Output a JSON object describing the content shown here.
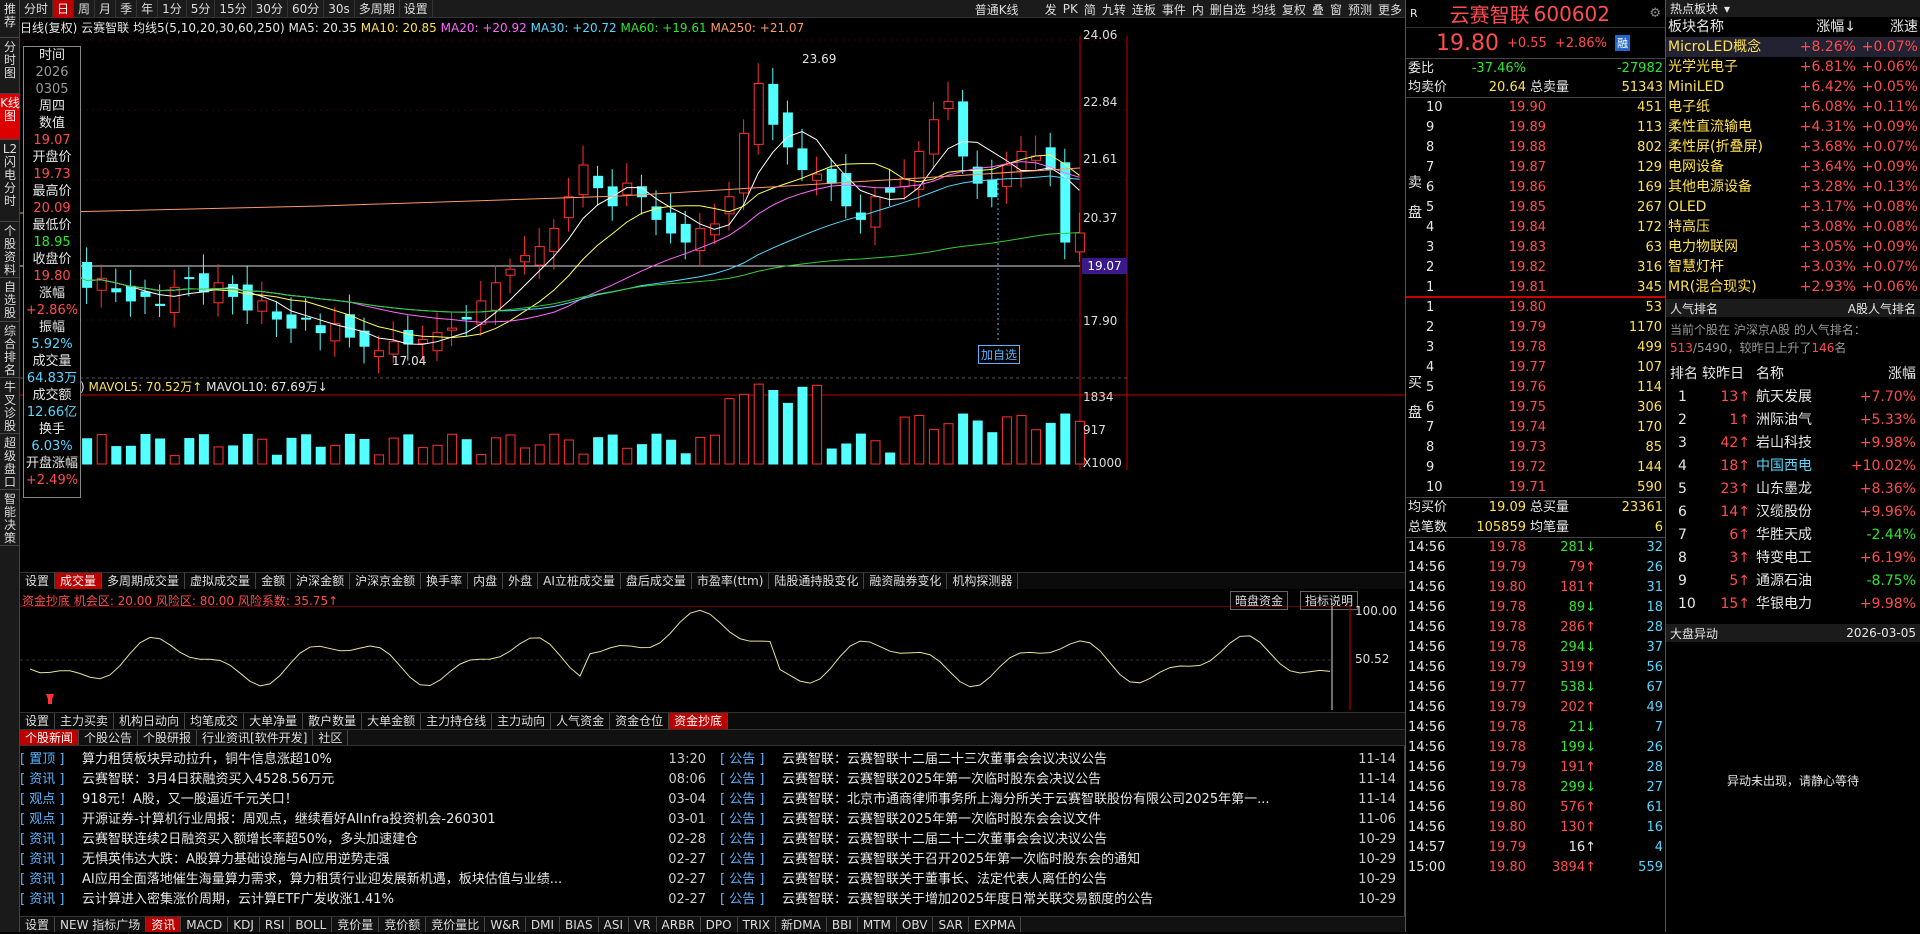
{
  "left_tabs": [
    "推荐",
    "分时图",
    "K线图",
    "L2闪电分时",
    "个股资料",
    "自选股",
    "综合排名",
    "牛叉诊股",
    "超级盘口",
    "智能决策"
  ],
  "top": {
    "periods": [
      "分时",
      "日",
      "周",
      "月",
      "季",
      "年",
      "1分",
      "5分",
      "15分",
      "30分",
      "60分",
      "30s",
      "多周期",
      "设置"
    ],
    "active_period": "日",
    "right": [
      "普通K线",
      "发",
      "PK",
      "简",
      "九转",
      "连板",
      "事件",
      "内",
      "删自选",
      "均线",
      "复权",
      "叠",
      "窗",
      "预测",
      "更多"
    ]
  },
  "chart": {
    "header": "日线(复权)  云赛智联  均线5(5,10,20,30,60,250)",
    "ma5": "MA5: 20.35",
    "ma10": "MA10: 20.85",
    "ma20": "MA20: +20.92",
    "ma30": "MA30: +20.72",
    "ma60": "MA60: +19.61",
    "ma250": "MA250: +21.07",
    "price_ticks": [
      "24.06",
      "22.84",
      "21.61",
      "20.37",
      "19.07",
      "17.90"
    ],
    "high_label": "23.69",
    "low_label": "17.04",
    "current_price_label": "19.07",
    "add_watch": "加自选"
  },
  "infobox": {
    "time_label": "时间",
    "date_year": "2026",
    "date_md": "0305",
    "weekday": "周四",
    "value_label": "数值",
    "value": "19.07",
    "open_label": "开盘价",
    "open": "19.73",
    "high_label": "最高价",
    "high": "20.09",
    "low_label": "最低价",
    "low": "18.95",
    "close_label": "收盘价",
    "close": "19.80",
    "chg_label": "涨幅",
    "chg": "+2.86%",
    "amp_label": "振幅",
    "amp": "5.92%",
    "vol_label": "成交量",
    "vol": "64.83万",
    "amt_label": "成交额",
    "amt": "12.66亿",
    "turn_label": "换手",
    "turn": "6.03%",
    "open_chg_label": "开盘涨幅",
    "open_chg": "+2.49%"
  },
  "volume": {
    "header_a": "万)",
    "mavol5": "MAVOL5: 70.52万↑",
    "mavol10": "MAVOL10: 67.69万↓",
    "ticks": [
      "1834",
      "917",
      "X1000"
    ]
  },
  "vol_tabs": [
    "设置",
    "成交量",
    "多周期成交量",
    "虚拟成交量",
    "金额",
    "沪深金额",
    "沪深京金额",
    "换手率",
    "内盘",
    "外盘",
    "AI立桩成交量",
    "盘后成交量",
    "市盈率(ttm)",
    "陆股通持股变化",
    "融资融券变化",
    "机构探测器"
  ],
  "indicator": {
    "header": "资金抄底 机会区: 20.00  风险区: 80.00  风险系数: 35.75↑",
    "btn1": "暗盘资金",
    "btn2": "指标说明",
    "ticks": [
      "100.00",
      "50.52"
    ]
  },
  "ind_tabs": [
    "设置",
    "主力买卖",
    "机构日动向",
    "均笔成交",
    "大单净量",
    "散户数量",
    "大单金额",
    "主力持仓线",
    "主力动向",
    "人气资金",
    "资金仓位",
    "资金抄底"
  ],
  "news_tabs": [
    "个股新闻",
    "个股公告",
    "个股研报",
    "行业资讯[软件开发]",
    "社区"
  ],
  "news_left": [
    [
      "置顶",
      "算力租赁板块异动拉升，铜牛信息涨超10%",
      "13:20"
    ],
    [
      "资讯",
      "云赛智联：3月4日获融资买入4528.56万元",
      "08:06"
    ],
    [
      "观点",
      "918元！A股，又一股逼近千元关口！",
      "03-04"
    ],
    [
      "观点",
      "开源证券-计算机行业周报：周观点，继续看好AIInfra投资机会-260301",
      "03-01"
    ],
    [
      "资讯",
      "云赛智联连续2日融资买入额增长率超50%，多头加速建仓",
      "02-28"
    ],
    [
      "资讯",
      "无惧英伟达大跌：A股算力基础设施与AI应用逆势走强",
      "02-27"
    ],
    [
      "资讯",
      "AI应用全面落地催生海量算力需求，算力租赁行业迎发展新机遇，板块估值与业绩...",
      "02-27"
    ],
    [
      "资讯",
      "云计算进入密集涨价周期，云计算ETF广发收涨1.41%",
      "02-27"
    ]
  ],
  "news_right": [
    [
      "公告",
      "云赛智联：云赛智联十二届二十三次董事会会议决议公告",
      "11-14"
    ],
    [
      "公告",
      "云赛智联：云赛智联2025年第一次临时股东会决议公告",
      "11-14"
    ],
    [
      "公告",
      "云赛智联：北京市通商律师事务所上海分所关于云赛智联股份有限公司2025年第一...",
      "11-14"
    ],
    [
      "公告",
      "云赛智联：云赛智联2025年第一次临时股东会会议文件",
      "11-06"
    ],
    [
      "公告",
      "云赛智联：云赛智联十二届二十二次董事会会议决议公告",
      "10-29"
    ],
    [
      "公告",
      "云赛智联：云赛智联关于召开2025年第一次临时股东会的通知",
      "10-29"
    ],
    [
      "公告",
      "云赛智联：云赛智联关于董事长、法定代表人离任的公告",
      "10-29"
    ],
    [
      "公告",
      "云赛智联：云赛智联关于增加2025年度日常关联交易额度的公告",
      "10-29"
    ]
  ],
  "bottom_tabs": [
    "设置",
    "NEW 指标广场",
    "资讯",
    "MACD",
    "KDJ",
    "RSI",
    "BOLL",
    "竞价量",
    "竞价额",
    "竞价量比",
    "W&R",
    "DMI",
    "BIAS",
    "ASI",
    "VR",
    "ARBR",
    "DPO",
    "TRIX",
    "新DMA",
    "BBI",
    "MTM",
    "OBV",
    "SAR",
    "EXPMA"
  ],
  "quote": {
    "badge": "R",
    "name": "云赛智联",
    "code": "600602",
    "price": "19.80",
    "chg": "+0.55",
    "pct": "+2.86%",
    "tag": "融",
    "weibi_label": "委比",
    "weibi": "-37.46%",
    "weicha": "-27982",
    "avg_label": "均卖价",
    "avg": "20.64",
    "total_label": "总卖量",
    "total": "51343",
    "sell_label": "卖盘",
    "buy_label": "买盘",
    "sells": [
      [
        "10",
        "19.90",
        "451"
      ],
      [
        "9",
        "19.89",
        "113"
      ],
      [
        "8",
        "19.88",
        "802"
      ],
      [
        "7",
        "19.87",
        "129"
      ],
      [
        "6",
        "19.86",
        "169"
      ],
      [
        "5",
        "19.85",
        "267"
      ],
      [
        "4",
        "19.84",
        "172"
      ],
      [
        "3",
        "19.83",
        "63"
      ],
      [
        "2",
        "19.82",
        "316"
      ],
      [
        "1",
        "19.81",
        "345"
      ]
    ],
    "buys": [
      [
        "1",
        "19.80",
        "53"
      ],
      [
        "2",
        "19.79",
        "1170"
      ],
      [
        "3",
        "19.78",
        "499"
      ],
      [
        "4",
        "19.77",
        "107"
      ],
      [
        "5",
        "19.76",
        "114"
      ],
      [
        "6",
        "19.75",
        "306"
      ],
      [
        "7",
        "19.74",
        "170"
      ],
      [
        "8",
        "19.73",
        "85"
      ],
      [
        "9",
        "19.72",
        "144"
      ],
      [
        "10",
        "19.71",
        "590"
      ]
    ],
    "avgbuy_label": "均买价",
    "avgbuy": "19.09",
    "totalbuy_label": "总买量",
    "totalbuy": "23361",
    "bishu_label": "总笔数",
    "bishu": "105859",
    "junbi_label": "均笔量",
    "junbi": "6"
  },
  "ticks": [
    [
      "14:56",
      "19.78",
      "281",
      "g",
      "32"
    ],
    [
      "14:56",
      "19.79",
      "79",
      "r",
      "26"
    ],
    [
      "14:56",
      "19.80",
      "181",
      "r",
      "31"
    ],
    [
      "14:56",
      "19.78",
      "89",
      "g",
      "18"
    ],
    [
      "14:56",
      "19.78",
      "286",
      "r",
      "28"
    ],
    [
      "14:56",
      "19.78",
      "294",
      "g",
      "37"
    ],
    [
      "14:56",
      "19.79",
      "319",
      "r",
      "56"
    ],
    [
      "14:56",
      "19.77",
      "538",
      "g",
      "67"
    ],
    [
      "14:56",
      "19.79",
      "202",
      "r",
      "49"
    ],
    [
      "14:56",
      "19.78",
      "21",
      "g",
      "7"
    ],
    [
      "14:56",
      "19.78",
      "199",
      "g",
      "26"
    ],
    [
      "14:56",
      "19.79",
      "191",
      "r",
      "28"
    ],
    [
      "14:56",
      "19.78",
      "299",
      "g",
      "27"
    ],
    [
      "14:56",
      "19.80",
      "576",
      "r",
      "61"
    ],
    [
      "14:56",
      "19.80",
      "130",
      "r",
      "16"
    ],
    [
      "14:57",
      "19.79",
      "16",
      "w",
      "4"
    ],
    [
      "15:00",
      "19.80",
      "3894",
      "r",
      "559"
    ]
  ],
  "hot": {
    "title": "热点板块",
    "col1": "板块名称",
    "col2": "涨幅↓",
    "col3": "涨速",
    "rows": [
      [
        "MicroLED概念",
        "+8.26%",
        "+0.07%"
      ],
      [
        "光学光电子",
        "+6.81%",
        "+0.06%"
      ],
      [
        "MiniLED",
        "+6.42%",
        "+0.05%"
      ],
      [
        "电子纸",
        "+6.08%",
        "+0.11%"
      ],
      [
        "柔性直流输电",
        "+4.31%",
        "+0.09%"
      ],
      [
        "柔性屏(折叠屏)",
        "+3.68%",
        "+0.07%"
      ],
      [
        "电网设备",
        "+3.64%",
        "+0.09%"
      ],
      [
        "其他电源设备",
        "+3.28%",
        "+0.13%"
      ],
      [
        "OLED",
        "+3.17%",
        "+0.08%"
      ],
      [
        "特高压",
        "+3.08%",
        "+0.08%"
      ],
      [
        "电力物联网",
        "+3.05%",
        "+0.09%"
      ],
      [
        "智慧灯杆",
        "+3.03%",
        "+0.07%"
      ],
      [
        "MR(混合现实)",
        "+2.93%",
        "+0.06%"
      ]
    ]
  },
  "pop": {
    "title": "人气排名",
    "scope": "A股人气排名",
    "desc1": "当前个股在 沪深京A股 的人气排名：",
    "rank": "513",
    "total": "/5490",
    "desc2": "，较昨日上升了",
    "up": "146",
    "desc3": "名",
    "h1": "排名",
    "h2": "较昨日",
    "h3": "名称",
    "h4": "涨幅",
    "rows": [
      [
        "1",
        "13",
        "航天发展",
        "+7.70%",
        "r"
      ],
      [
        "2",
        "1",
        "洲际油气",
        "+5.33%",
        "r"
      ],
      [
        "3",
        "42",
        "岩山科技",
        "+9.98%",
        "r"
      ],
      [
        "4",
        "18",
        "中国西电",
        "+10.02%",
        "r"
      ],
      [
        "5",
        "23",
        "山东墨龙",
        "+8.36%",
        "r"
      ],
      [
        "6",
        "14",
        "汉缆股份",
        "+9.96%",
        "r"
      ],
      [
        "7",
        "6",
        "华胜天成",
        "-2.44%",
        "g"
      ],
      [
        "8",
        "3",
        "特变电工",
        "+6.19%",
        "r"
      ],
      [
        "9",
        "5",
        "通源石油",
        "-8.75%",
        "g"
      ],
      [
        "10",
        "15",
        "华银电力",
        "+9.98%",
        "r"
      ]
    ]
  },
  "market": {
    "title": "大盘异动",
    "date": "2026-03-05",
    "empty": "异动未出现，请静心等待"
  }
}
